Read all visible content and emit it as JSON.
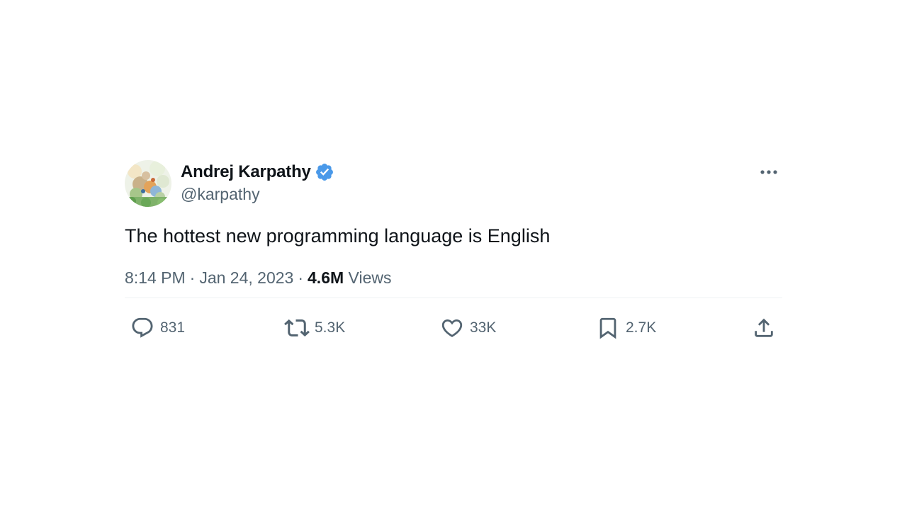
{
  "author": {
    "display_name": "Andrej Karpathy",
    "handle": "@karpathy",
    "verified": true,
    "verified_color": "#4a99e9"
  },
  "tweet": {
    "text": "The hottest new programming language is English",
    "time": "8:14 PM",
    "date": "Jan 24, 2023",
    "separator": "·",
    "views_count": "4.6M",
    "views_label": "Views"
  },
  "actions": {
    "reply_count": "831",
    "retweet_count": "5.3K",
    "like_count": "33K",
    "bookmark_count": "2.7K"
  },
  "icons": {
    "reply": "reply-icon",
    "retweet": "retweet-icon",
    "like": "heart-icon",
    "bookmark": "bookmark-icon",
    "share": "share-icon",
    "more": "more-options-icon",
    "verified": "verified-badge-icon"
  },
  "colors": {
    "primary_text": "#0f1419",
    "secondary_text": "#536471",
    "divider": "#eff3f4"
  }
}
